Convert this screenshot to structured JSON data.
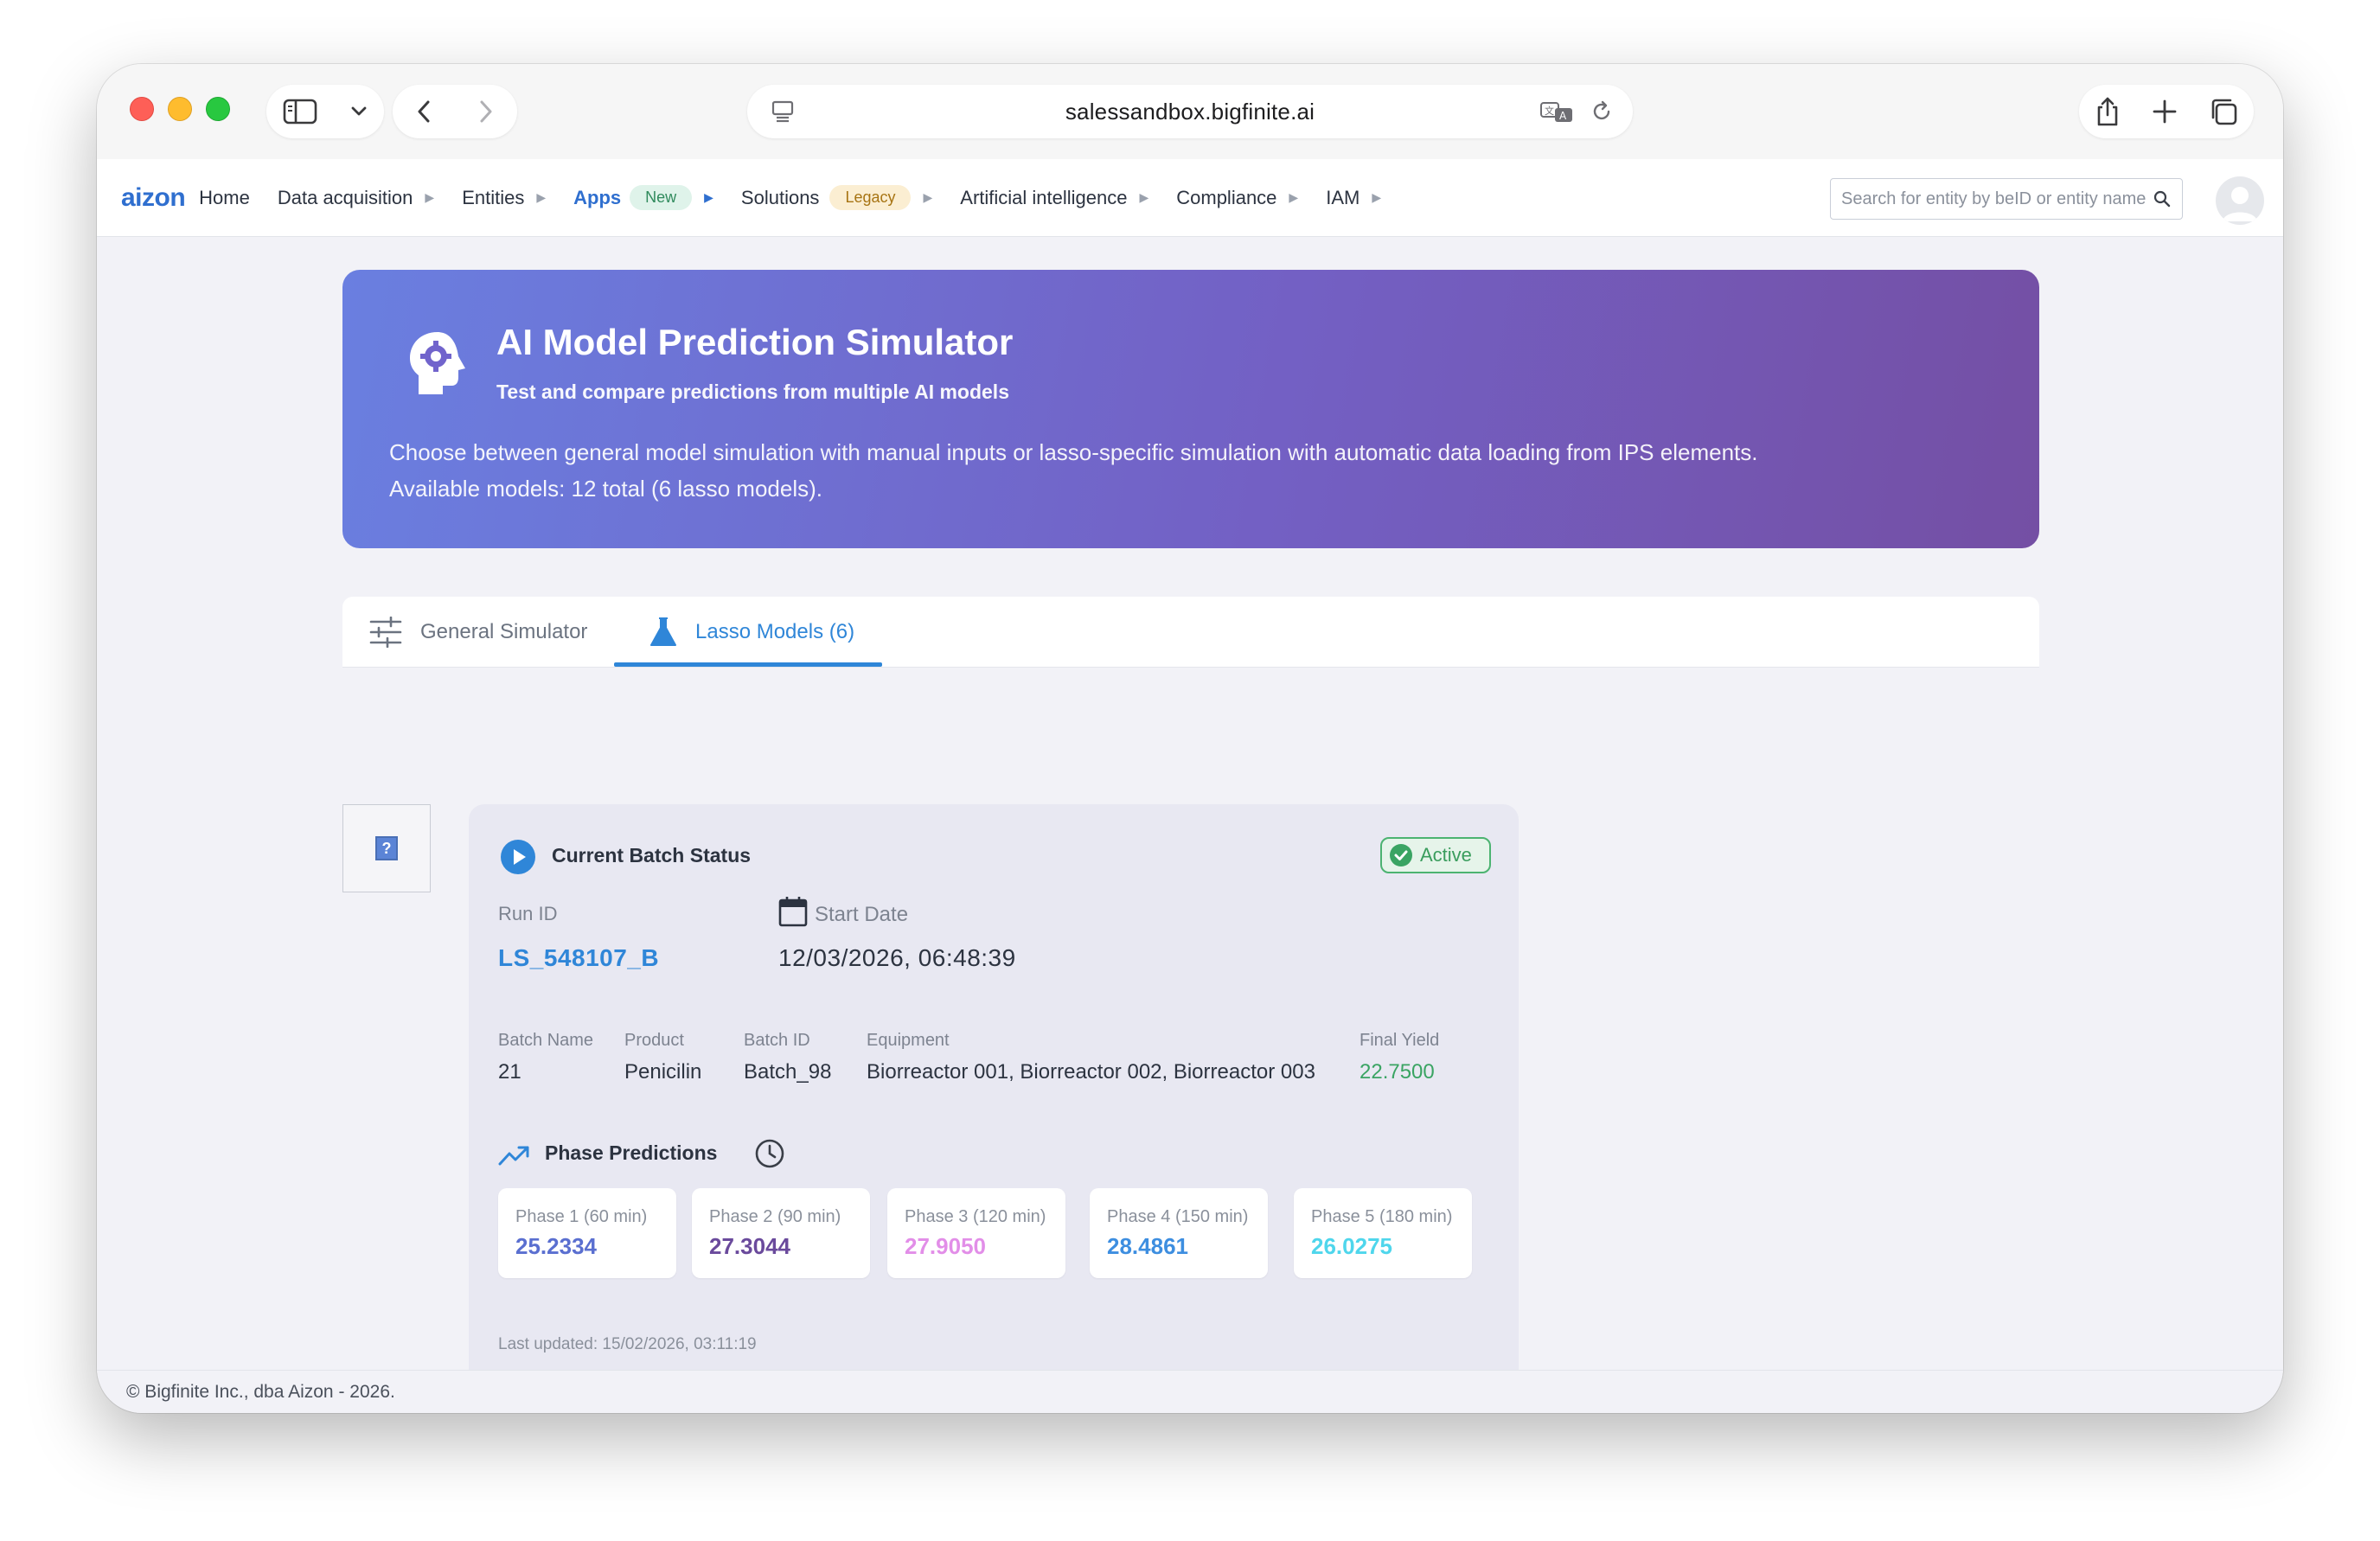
{
  "browser": {
    "url": "salessandbox.bigfinite.ai"
  },
  "header": {
    "logo": "aizon",
    "nav": [
      {
        "label": "Home",
        "caret": false
      },
      {
        "label": "Data acquisition",
        "caret": true
      },
      {
        "label": "Entities",
        "caret": true
      },
      {
        "label": "Apps",
        "caret": true,
        "badge": "New",
        "active": true
      },
      {
        "label": "Solutions",
        "caret": true,
        "badge": "Legacy"
      },
      {
        "label": "Artificial intelligence",
        "caret": true
      },
      {
        "label": "Compliance",
        "caret": true
      },
      {
        "label": "IAM",
        "caret": true
      }
    ],
    "search_placeholder": "Search for entity by beID or entity name"
  },
  "hero": {
    "title": "AI Model Prediction Simulator",
    "subtitle": "Test and compare predictions from multiple AI models",
    "description_line1": "Choose between general model simulation with manual inputs or lasso-specific simulation with automatic data loading from IPS elements.",
    "description_line2": "Available models: 12 total (6 lasso models)."
  },
  "tabs": [
    {
      "label": "General Simulator",
      "active": false
    },
    {
      "label": "Lasso Models (6)",
      "active": true
    }
  ],
  "batch": {
    "title": "Current Batch Status",
    "status": "Active",
    "run_id_label": "Run ID",
    "run_id": "LS_548107_B",
    "start_date_label": "Start Date",
    "start_date": "12/03/2026, 06:48:39",
    "fields": [
      {
        "label": "Batch Name",
        "value": "21"
      },
      {
        "label": "Product",
        "value": "Penicilin"
      },
      {
        "label": "Batch ID",
        "value": "Batch_98"
      },
      {
        "label": "Equipment",
        "value": "Biorreactor 001, Biorreactor 002, Biorreactor 003"
      },
      {
        "label": "Final Yield",
        "value": "22.7500"
      }
    ],
    "phase_title": "Phase Predictions",
    "phases": [
      {
        "label": "Phase 1 (60 min)",
        "value": "25.2334",
        "color": "#5a6fd0"
      },
      {
        "label": "Phase 2 (90 min)",
        "value": "27.3044",
        "color": "#6a4a9c"
      },
      {
        "label": "Phase 3 (120 min)",
        "value": "27.9050",
        "color": "#e28ee8"
      },
      {
        "label": "Phase 4 (150 min)",
        "value": "28.4861",
        "color": "#3d8ee0"
      },
      {
        "label": "Phase 5 (180 min)",
        "value": "26.0275",
        "color": "#4fd6ec"
      }
    ],
    "last_updated": "Last updated: 15/02/2026, 03:11:19"
  },
  "footer": {
    "text": "© Bigfinite Inc., dba Aizon - 2026."
  },
  "colors": {
    "accent": "#2f86d8",
    "success": "#3aa463"
  }
}
